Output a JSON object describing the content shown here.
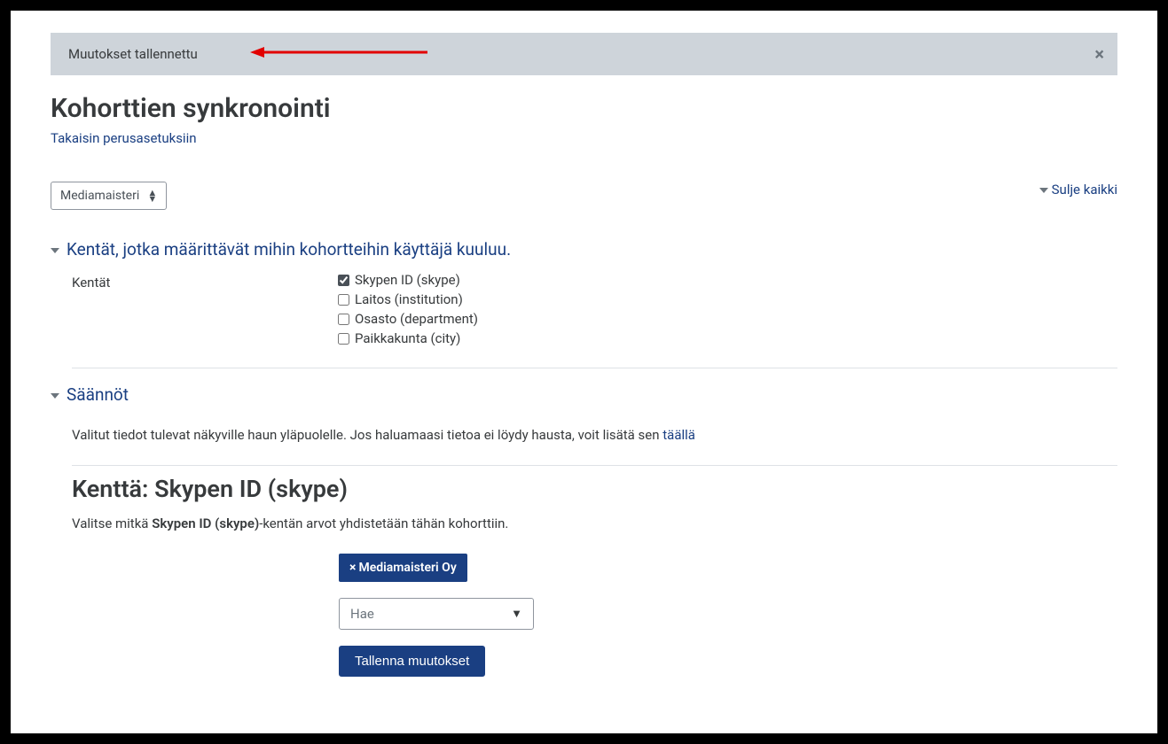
{
  "alert": {
    "message": "Muutokset tallennettu",
    "close_label": "×"
  },
  "page": {
    "title": "Kohorttien synkronointi",
    "back_link": "Takaisin perusasetuksiin"
  },
  "category_select": {
    "value": "Mediamaisteri"
  },
  "collapse_all": "Sulje kaikki",
  "section1": {
    "title": "Kentät, jotka määrittävät mihin kohortteihin käyttäjä kuuluu.",
    "label": "Kentät",
    "options": [
      {
        "label": "Skypen ID (skype)",
        "checked": true
      },
      {
        "label": "Laitos (institution)",
        "checked": false
      },
      {
        "label": "Osasto (department)",
        "checked": false
      },
      {
        "label": "Paikkakunta (city)",
        "checked": false
      }
    ]
  },
  "section2": {
    "title": "Säännöt",
    "info_prefix": "Valitut tiedot tulevat näkyville haun yläpuolelle. Jos haluamaasi tietoa ei löydy hausta, voit lisätä sen ",
    "info_link": "täällä"
  },
  "field": {
    "title": "Kenttä: Skypen ID (skype)",
    "desc_prefix": "Valitse mitkä ",
    "desc_bold": "Skypen ID (skype)",
    "desc_suffix": "-kentän arvot yhdistetään tähän kohorttiin.",
    "tag": "Mediamaisteri Oy",
    "search_placeholder": "Hae",
    "save_button": "Tallenna muutokset"
  }
}
